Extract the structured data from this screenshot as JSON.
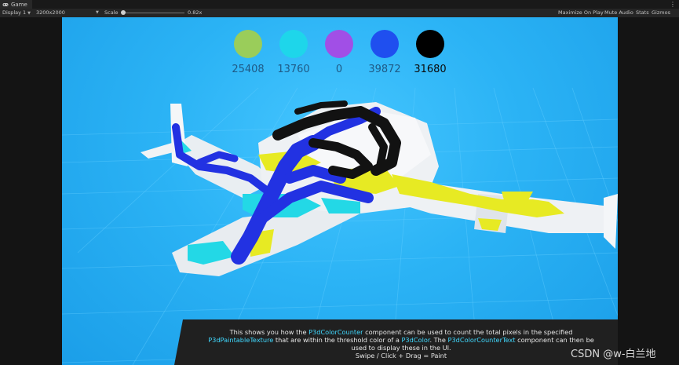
{
  "tab": {
    "icon": "gamepad-icon",
    "title": "Game",
    "menu_glyph": "⋮"
  },
  "toolbar": {
    "display": "Display 1",
    "resolution": "3200x2000",
    "scale_label": "Scale",
    "scale_value": "0.82x",
    "buttons": [
      "Maximize On Play",
      "Mute Audio",
      "Stats",
      "Gizmos"
    ]
  },
  "counter": {
    "swatches": [
      {
        "color": "#9acd5a",
        "count": "25408"
      },
      {
        "color": "#1ed6ea",
        "count": "13760"
      },
      {
        "color": "#a14fe6",
        "count": "0"
      },
      {
        "color": "#1f4fef",
        "count": "39872"
      },
      {
        "color": "#000000",
        "count": "31680"
      }
    ]
  },
  "description": {
    "l1a": "This shows you how the ",
    "l1b": "P3dColorCounter",
    "l1c": " component can be used to count the total pixels in the specified",
    "l2a": "P3dPaintableTexture",
    "l2b": " that are within the threshold color of a ",
    "l2c": "P3dColor",
    "l2d": ". The ",
    "l2e": "P3dColorCounterText",
    "l2f": " component can then be",
    "l3": "used to display these in the UI.",
    "l4": "Swipe / Click + Drag = Paint"
  },
  "watermark": "CSDN @w-白兰地"
}
